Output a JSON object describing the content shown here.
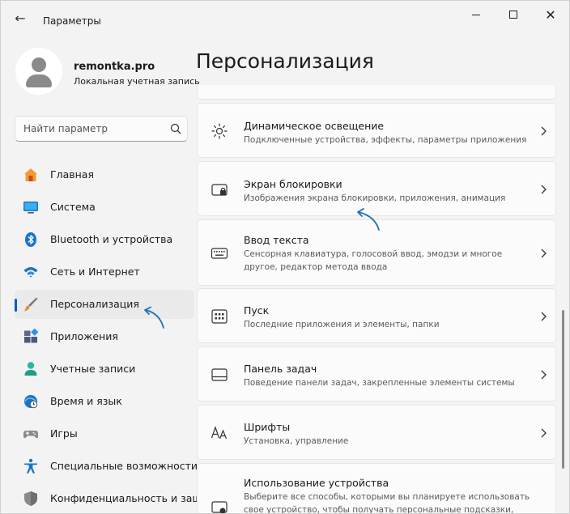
{
  "window": {
    "title": "Параметры",
    "close_glyph": "✕",
    "back_glyph": "←"
  },
  "profile": {
    "name": "remontka.pro",
    "account_type": "Локальная учетная запись"
  },
  "search": {
    "placeholder": "Найти параметр"
  },
  "nav": {
    "items": [
      {
        "label": "Главная",
        "icon": "home-icon"
      },
      {
        "label": "Система",
        "icon": "system-icon"
      },
      {
        "label": "Bluetooth и устройства",
        "icon": "bluetooth-icon"
      },
      {
        "label": "Сеть и Интернет",
        "icon": "wifi-icon"
      },
      {
        "label": "Персонализация",
        "icon": "brush-icon",
        "active": true
      },
      {
        "label": "Приложения",
        "icon": "apps-icon"
      },
      {
        "label": "Учетные записи",
        "icon": "account-icon"
      },
      {
        "label": "Время и язык",
        "icon": "time-language-icon"
      },
      {
        "label": "Игры",
        "icon": "gamepad-icon"
      },
      {
        "label": "Специальные возможности",
        "icon": "accessibility-icon"
      },
      {
        "label": "Конфиденциальность и защита",
        "icon": "shield-icon"
      }
    ]
  },
  "main": {
    "title": "Персонализация",
    "cards": [
      {
        "title": "Динамическое освещение",
        "desc": "Подключенные устройства, эффекты, параметры приложения",
        "icon": "dynamic-lighting-icon"
      },
      {
        "title": "Экран блокировки",
        "desc": "Изображения экрана блокировки, приложения, анимация",
        "icon": "lock-screen-icon"
      },
      {
        "title": "Ввод текста",
        "desc": "Сенсорная клавиатура, голосовой ввод, эмодзи и многое другое, редактор метода ввода",
        "icon": "keyboard-icon"
      },
      {
        "title": "Пуск",
        "desc": "Последние приложения и элементы, папки",
        "icon": "start-icon"
      },
      {
        "title": "Панель задач",
        "desc": "Поведение панели задач, закрепленные элементы системы",
        "icon": "taskbar-icon"
      },
      {
        "title": "Шрифты",
        "desc": "Установка, управление",
        "icon": "fonts-icon"
      },
      {
        "title": "Использование устройства",
        "desc": "Выберите все способы, которыми вы планируете использовать свое устройство, чтобы получать персональные подсказки,",
        "icon": "device-usage-icon"
      }
    ]
  },
  "colors": {
    "accent": "#005fb8",
    "annotation_arrow": "#1e6fb5"
  }
}
